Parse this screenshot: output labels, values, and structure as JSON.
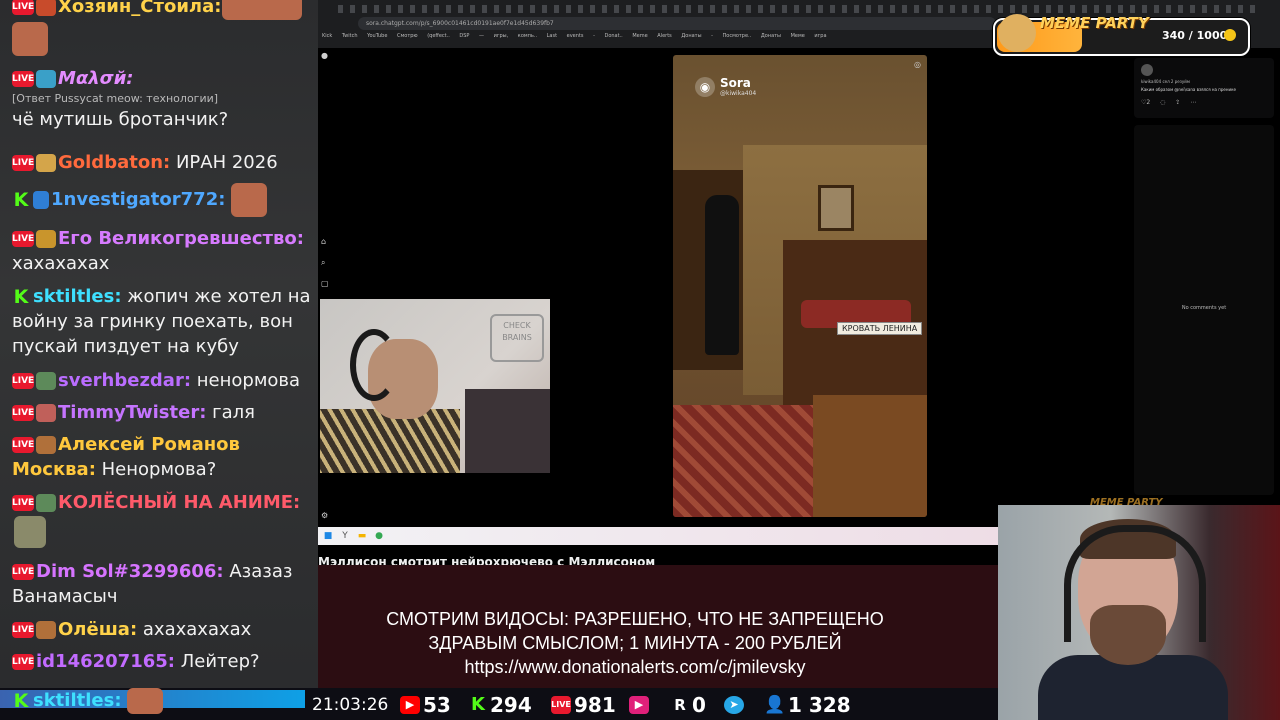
{
  "chat": {
    "messages": [
      {
        "badge": "LIVE",
        "user": "Хозяин_Стоила:",
        "text": "",
        "color": "#ffd24a"
      },
      {
        "badge": "LIVE",
        "user": "Мαλσй:",
        "reply": "[Ответ Pussycat meow: технологии]",
        "text": "чё мутишь бротанчик?",
        "color": "#e48cff"
      },
      {
        "badge": "LIVE",
        "user": "Goldbaton:",
        "text": "ИРАН 2026",
        "color": "#ff6a3d"
      },
      {
        "badge": "K",
        "user": "1nvestigator772:",
        "text": "",
        "color": "#4fa8ff"
      },
      {
        "badge": "LIVE",
        "user": "Его Великогревшество:",
        "text": "хахахахах",
        "color": "#d77bff"
      },
      {
        "badge": "K",
        "user": "sktiltles:",
        "text": "жопич же хотел на войну за гринку поехать, вон пускай пиздует на кубу",
        "color": "#3ee0ff"
      },
      {
        "badge": "LIVE",
        "user": "sverhbezdar:",
        "text": "ненормова",
        "color": "#ba6dff"
      },
      {
        "badge": "LIVE",
        "user": "TimmyTwister:",
        "text": "галя",
        "color": "#c574ff"
      },
      {
        "badge": "LIVE",
        "user": "Алексей Романов Москва:",
        "text": "Ненормова?",
        "color": "#ffc83d"
      },
      {
        "badge": "LIVE",
        "user": "КОЛЁСНЫЙ НА АНИМЕ:",
        "text": "",
        "color": "#ff5a6a"
      },
      {
        "badge": "LIVE",
        "user": "Dim Sol#3299606:",
        "text": "Азазаз Ванамасыч",
        "color": "#d674ff"
      },
      {
        "badge": "LIVE",
        "user": "Олёша:",
        "text": "ахахахахах",
        "color": "#ffd24a"
      },
      {
        "badge": "LIVE",
        "user": "id146207165:",
        "text": "Лейтер?",
        "color": "#c26bff"
      },
      {
        "badge": "K",
        "user": "sktiltles:",
        "text": "",
        "color": "#3ee0ff"
      }
    ]
  },
  "browser": {
    "url": "sora.chatgpt.com/p/s_6900c01461cd0191ae0f7e1d45d639fb7",
    "bookmarks": "Kick  Twitch  YouTube  Смотрю (qeffect..  DSP — игры, компь..  Last events - Donat..  Meme Alerts  Донаты - Посмотре..  Донаты Меме игра"
  },
  "sora": {
    "title": "Sora",
    "username": "@kiwika404",
    "overlay_label": "КРОВАТЬ ЛЕНИНА"
  },
  "comments": {
    "username": "kiwika404",
    "time": "сел 2 резуйм",
    "text": "Каким образом @nei\\sana взялся на пренике",
    "likes": "2",
    "empty_label": "No comments yet"
  },
  "stream": {
    "title": "Мэллисон смотрит нейрохрючево с Мэллисоном",
    "banner_lines": [
      "СМОТРИМ ВИДОСЫ: РАЗРЕШЕНО, ЧТО НЕ ЗАПРЕЩЕНО",
      "ЗДРАВЫМ СМЫСЛОМ; 1 МИНУТА - 200 РУБЛЕЙ",
      "https://www.donationalerts.com/c/jmilevsky"
    ]
  },
  "status": {
    "time": "21:03:26",
    "youtube": "53",
    "kick": "294",
    "vk_live": "981",
    "rutube": "0",
    "viewers": "1 328"
  },
  "meme_party": {
    "title": "MEME PARTY",
    "count": "340 / 1000",
    "progress": 0.34
  },
  "colors": {
    "live_badge": "#e8192e",
    "kick_green": "#53fc18",
    "banner_bg": "#2c0d12",
    "meme_orange": "#ff9a1a"
  }
}
